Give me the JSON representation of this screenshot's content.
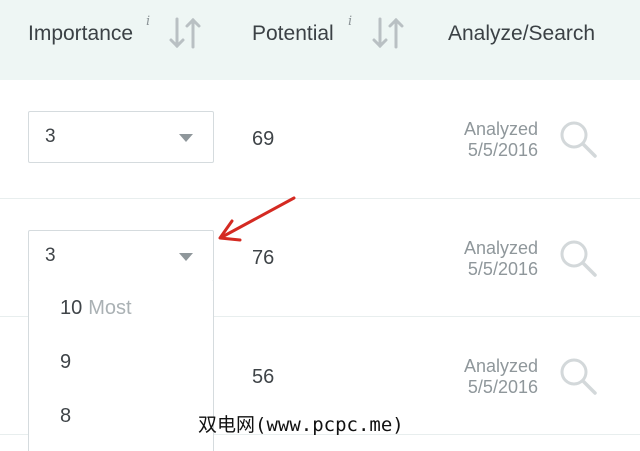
{
  "header": {
    "importance_label": "Importance",
    "potential_label": "Potential",
    "analyze_label": "Analyze/Search",
    "info_glyph": "i"
  },
  "rows": [
    {
      "importance": "3",
      "potential": "69",
      "status": "Analyzed",
      "date": "5/5/2016"
    },
    {
      "importance": "3",
      "potential": "76",
      "status": "Analyzed",
      "date": "5/5/2016"
    },
    {
      "potential": "56",
      "status": "Analyzed",
      "date": "5/5/2016"
    }
  ],
  "dropdown": {
    "options": [
      {
        "value": "10",
        "note": "Most"
      },
      {
        "value": "9"
      },
      {
        "value": "8"
      }
    ]
  },
  "watermark": "双电网(www.pcpc.me)",
  "colors": {
    "header_bg": "#eef6f4",
    "annotation_arrow": "#d42a22",
    "muted_text": "#8f979b"
  },
  "icons": [
    "info-icon",
    "sort-icon",
    "search-icon",
    "chevron-down-icon",
    "annotation-arrow"
  ]
}
